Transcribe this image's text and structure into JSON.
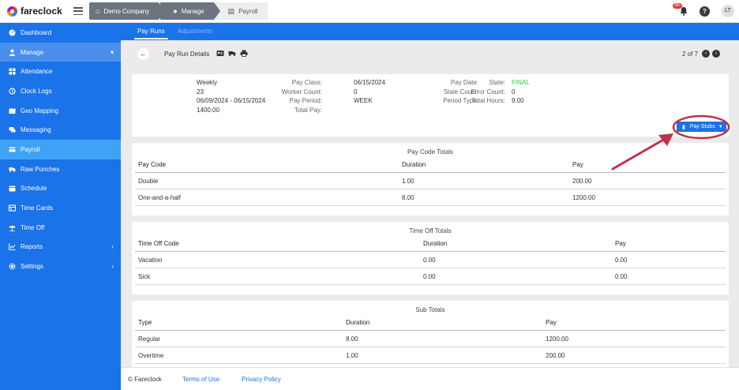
{
  "app": {
    "logo": "fareclock"
  },
  "breadcrumb": [
    {
      "label": "Demo Company",
      "icon": "home-icon"
    },
    {
      "label": "Manage",
      "icon": "user-icon"
    },
    {
      "label": "Payroll",
      "icon": "payroll-icon"
    }
  ],
  "topbar": {
    "notification_count": "99+",
    "help": "?",
    "avatar": "LT"
  },
  "sidebar": {
    "items": [
      {
        "label": "Dashboard",
        "icon": "dashboard-icon"
      },
      {
        "label": "Manage",
        "icon": "user-icon"
      },
      {
        "label": "Attendance",
        "icon": "attendance-icon"
      },
      {
        "label": "Clock Logs",
        "icon": "history-icon"
      },
      {
        "label": "Geo Mapping",
        "icon": "map-icon"
      },
      {
        "label": "Messaging",
        "icon": "chat-icon"
      },
      {
        "label": "Payroll",
        "icon": "payroll-icon"
      },
      {
        "label": "Raw Punches",
        "icon": "truck-icon"
      },
      {
        "label": "Schedule",
        "icon": "calendar-icon"
      },
      {
        "label": "Time Cards",
        "icon": "card-icon"
      },
      {
        "label": "Time Off",
        "icon": "umbrella-icon"
      },
      {
        "label": "Reports",
        "icon": "chart-icon"
      },
      {
        "label": "Settings",
        "icon": "gear-icon"
      }
    ]
  },
  "tabs": [
    {
      "label": "Pay Runs"
    },
    {
      "label": "Adjustments"
    }
  ],
  "header": {
    "title": "Pay Run Details",
    "pager": "2 of 7"
  },
  "info": {
    "pay_class_label": "Pay Class:",
    "pay_class": "Weekly",
    "worker_count_label": "Worker Count:",
    "worker_count": "23",
    "pay_period_label": "Pay Period:",
    "pay_period": "06/09/2024 - 06/15/2024",
    "total_pay_label": "Total Pay:",
    "total_pay": "1400.00",
    "pay_date_label": "Pay Date:",
    "pay_date": "06/15/2024",
    "stale_count_label": "Stale Count:",
    "stale_count": "0",
    "period_type_label": "Period Type:",
    "period_type": "WEEK",
    "state_label": "State:",
    "state": "FINAL",
    "error_count_label": "Error Count:",
    "error_count": "0",
    "total_hours_label": "Total Hours:",
    "total_hours": "9.00",
    "pay_stubs_button": "Pay Stubs"
  },
  "pay_code_totals": {
    "title": "Pay Code Totals",
    "headers": [
      "Pay Code",
      "Duration",
      "Pay"
    ],
    "rows": [
      [
        "Double",
        "1.00",
        "200.00"
      ],
      [
        "One-and-a-half",
        "8.00",
        "1200.00"
      ]
    ]
  },
  "time_off_totals": {
    "title": "Time Off Totals",
    "headers": [
      "Time Off Code",
      "Duration",
      "Pay"
    ],
    "rows": [
      [
        "Vacation",
        "0.00",
        "0.00"
      ],
      [
        "Sick",
        "0.00",
        "0.00"
      ]
    ]
  },
  "sub_totals": {
    "title": "Sub Totals",
    "headers": [
      "Type",
      "Duration",
      "Pay"
    ],
    "rows": [
      [
        "Regular",
        "8.00",
        "1200.00"
      ],
      [
        "Overtime",
        "1.00",
        "200.00"
      ]
    ]
  },
  "footer": {
    "copyright": "© Fareclock",
    "terms": "Terms of Use",
    "privacy": "Privacy Policy"
  },
  "colors": {
    "primary": "#1a73e8",
    "active_nav": "#3fa3f5",
    "final_state": "#2ecc40",
    "annotation": "#c0304a"
  }
}
